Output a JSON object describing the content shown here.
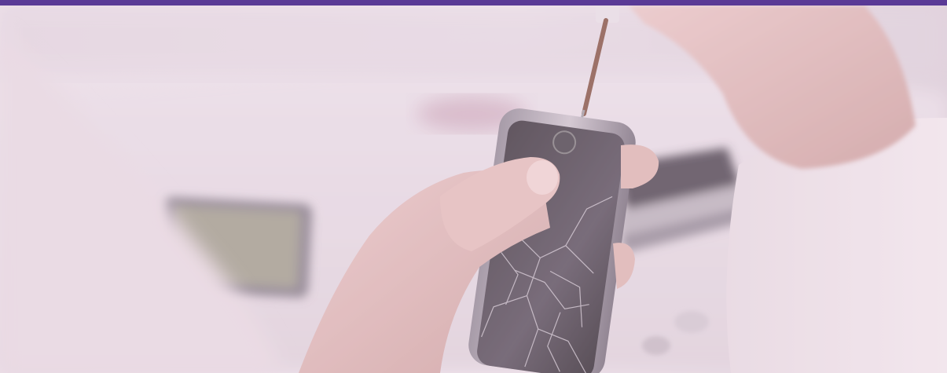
{
  "colors": {
    "top_bar": "#5a3a96",
    "overlay_tint": "#f3d6ea",
    "overlay_opacity": 0.28
  },
  "image": {
    "scene": "hands-repairing-cracked-smartphone"
  }
}
